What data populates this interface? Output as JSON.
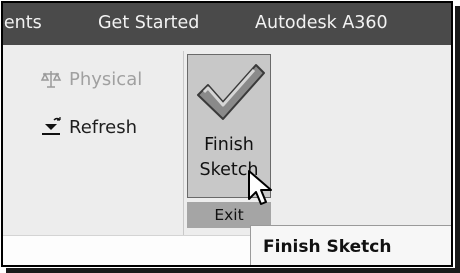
{
  "tabs": [
    {
      "label": "ients"
    },
    {
      "label": "Get Started"
    },
    {
      "label": "Autodesk A360"
    }
  ],
  "commands": {
    "physical": {
      "label": "Physical",
      "icon": "balance-scale-icon",
      "enabled": false
    },
    "refresh": {
      "label": "Refresh",
      "icon": "refresh-icon",
      "enabled": true
    }
  },
  "finish_sketch": {
    "line1": "Finish",
    "line2": "Sketch",
    "icon": "checkmark-icon"
  },
  "exit_panel": {
    "label": "Exit"
  },
  "tooltip": {
    "text": "Finish Sketch"
  },
  "colors": {
    "tabbar": "#4a4a4a",
    "ribbon": "#ededed",
    "button_active": "#c8c8c8",
    "panel_label": "#a5a5a5"
  }
}
